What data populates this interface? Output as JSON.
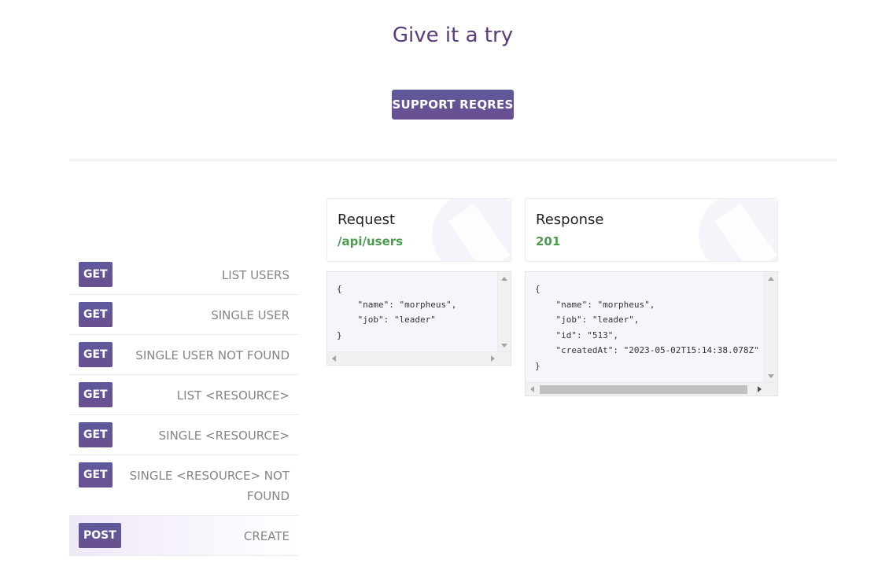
{
  "header": {
    "title": "Give it a try",
    "support_button": "SUPPORT REQRES"
  },
  "endpoints": [
    {
      "method": "GET",
      "label": "LIST USERS"
    },
    {
      "method": "GET",
      "label": "SINGLE USER"
    },
    {
      "method": "GET",
      "label": "SINGLE USER NOT FOUND"
    },
    {
      "method": "GET",
      "label": "LIST <RESOURCE>"
    },
    {
      "method": "GET",
      "label": "SINGLE <RESOURCE>"
    },
    {
      "method": "GET",
      "label": "SINGLE <RESOURCE> NOT FOUND"
    },
    {
      "method": "POST",
      "label": "CREATE",
      "active": true
    }
  ],
  "request": {
    "title": "Request",
    "path": "/api/users",
    "body_lines": [
      "{",
      "    \"name\": \"morpheus\",",
      "    \"job\": \"leader\"",
      "}"
    ]
  },
  "response": {
    "title": "Response",
    "status": "201",
    "body_lines": [
      "{",
      "    \"name\": \"morpheus\",",
      "    \"job\": \"leader\",",
      "    \"id\": \"513\",",
      "    \"createdAt\": \"2023-05-02T15:14:38.078Z\"",
      "}"
    ]
  },
  "colors": {
    "accent": "#5d5a9c",
    "status_green": "#4e9a52",
    "title_purple": "#5a3c78"
  }
}
